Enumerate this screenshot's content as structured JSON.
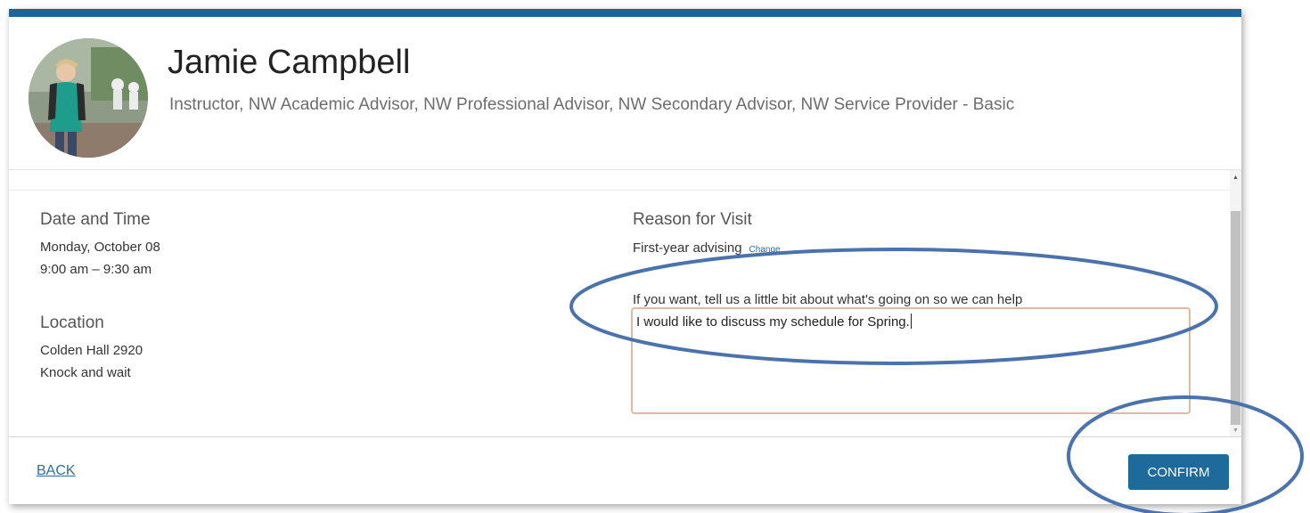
{
  "profile": {
    "name": "Jamie Campbell",
    "roles": "Instructor, NW Academic Advisor, NW Professional Advisor, NW Secondary Advisor, NW Service Provider - Basic"
  },
  "date_time": {
    "title": "Date and Time",
    "date": "Monday, October 08",
    "time": "9:00 am – 9:30 am"
  },
  "location": {
    "title": "Location",
    "place": "Colden Hall 2920",
    "note": "Knock and wait"
  },
  "reason": {
    "title": "Reason for Visit",
    "value": "First-year advising",
    "change_label": "Change",
    "prompt": "If you want, tell us a little bit about what's going on so we can help",
    "textarea_value": "I would like to discuss my schedule for Spring."
  },
  "footer": {
    "back_label": "BACK",
    "confirm_label": "CONFIRM"
  },
  "colors": {
    "accent": "#1f6496",
    "button": "#1e6a9a",
    "link": "#2a6ea5",
    "annotation_ellipse": "#4a73ad",
    "textarea_border": "#e0b9a4"
  },
  "icons": [
    "scroll-up-arrow-icon",
    "scroll-down-arrow-icon",
    "avatar-photo"
  ]
}
